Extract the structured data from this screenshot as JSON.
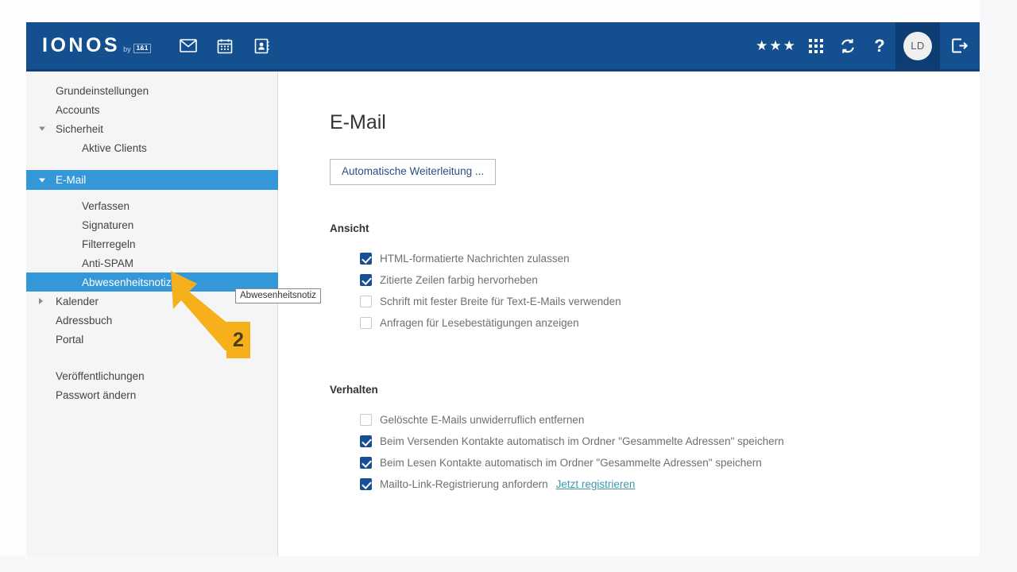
{
  "brand": {
    "logo_text": "IONOS",
    "logo_by": "by",
    "logo_badge": "1&1"
  },
  "navbar": {
    "left_icons": [
      {
        "name": "mail-icon",
        "label": "E-Mail"
      },
      {
        "name": "calendar-icon",
        "label": "Kalender"
      },
      {
        "name": "addressbook-icon",
        "label": "Adressbuch"
      }
    ],
    "stars": "★★★",
    "right_icons": [
      {
        "name": "apps-grid-icon",
        "label": "Apps"
      },
      {
        "name": "sync-icon",
        "label": "Synchronisieren"
      },
      {
        "name": "help-icon",
        "label": "Hilfe"
      }
    ],
    "avatar_initials": "LD",
    "logout_label": "Abmelden"
  },
  "sidebar": {
    "items": [
      {
        "label": "Grundeinstellungen",
        "level": 1,
        "caret": "none",
        "active": false
      },
      {
        "label": "Accounts",
        "level": 1,
        "caret": "none",
        "active": false
      },
      {
        "label": "Sicherheit",
        "level": 1,
        "caret": "down",
        "active": false
      },
      {
        "label": "Aktive Clients",
        "level": 2,
        "caret": "none",
        "active": false
      },
      {
        "label": "E-Mail",
        "level": 1,
        "caret": "down",
        "active": true
      },
      {
        "label": "Verfassen",
        "level": 2,
        "caret": "none",
        "active": false
      },
      {
        "label": "Signaturen",
        "level": 2,
        "caret": "none",
        "active": false
      },
      {
        "label": "Filterregeln",
        "level": 2,
        "caret": "none",
        "active": false
      },
      {
        "label": "Anti-SPAM",
        "level": 2,
        "caret": "none",
        "active": false
      },
      {
        "label": "Abwesenheitsnotiz",
        "level": 2,
        "caret": "none",
        "active": true
      },
      {
        "label": "Kalender",
        "level": 1,
        "caret": "right",
        "active": false
      },
      {
        "label": "Adressbuch",
        "level": 1,
        "caret": "none",
        "active": false
      },
      {
        "label": "Portal",
        "level": 1,
        "caret": "none",
        "active": false
      },
      {
        "label": "Veröffentlichungen",
        "level": 1,
        "caret": "none",
        "active": false
      },
      {
        "label": "Passwort ändern",
        "level": 1,
        "caret": "none",
        "active": false
      }
    ]
  },
  "main": {
    "title": "E-Mail",
    "forward_button": "Automatische Weiterleitung ...",
    "sections": [
      {
        "title": "Ansicht",
        "options": [
          {
            "label": "HTML-formatierte Nachrichten zulassen",
            "checked": true
          },
          {
            "label": "Zitierte Zeilen farbig hervorheben",
            "checked": true
          },
          {
            "label": "Schrift mit fester Breite für Text-E-Mails verwenden",
            "checked": false
          },
          {
            "label": "Anfragen für Lesebestätigungen anzeigen",
            "checked": false
          }
        ]
      },
      {
        "title": "Verhalten",
        "options": [
          {
            "label": "Gelöschte E-Mails unwiderruflich entfernen",
            "checked": false
          },
          {
            "label": "Beim Versenden Kontakte automatisch im Ordner \"Gesammelte Adressen\" speichern",
            "checked": true
          },
          {
            "label": "Beim Lesen Kontakte automatisch im Ordner \"Gesammelte Adressen\" speichern",
            "checked": true
          },
          {
            "label": "Mailto-Link-Registrierung anfordern",
            "checked": true,
            "link": "Jetzt registrieren"
          }
        ]
      }
    ]
  },
  "annotation": {
    "tooltip_text": "Abwesenheitsnotiz",
    "step_number": "2",
    "arrow_color": "#f5b01c"
  },
  "colors": {
    "navbar_bg": "#14508f",
    "navbar_bg_dark": "#0e3d74",
    "sidebar_bg": "#f5f5f5",
    "active_row": "#3498d8",
    "checkbox_on": "#174f94",
    "link": "#3d9aa5",
    "button_text": "#2a4f7f",
    "accent_annotation": "#f5b01c"
  }
}
